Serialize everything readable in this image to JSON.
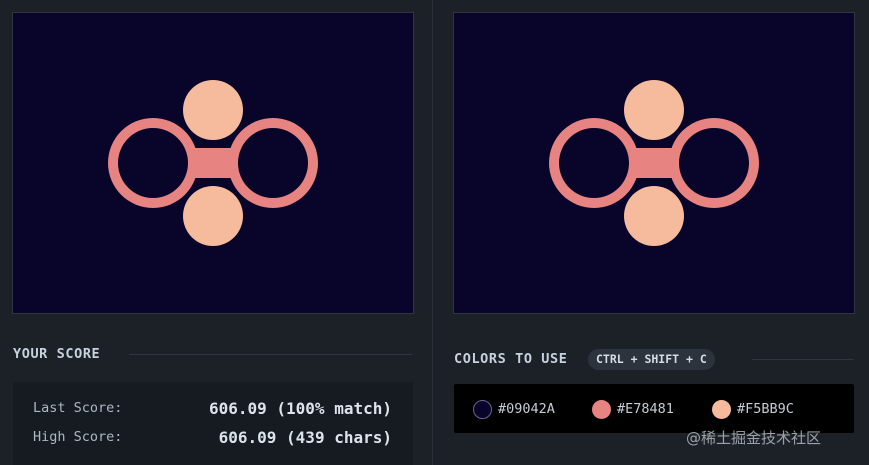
{
  "palette": {
    "background": "#09042A",
    "ring": "#E78481",
    "circle": "#F5BB9C"
  },
  "score": {
    "title": "YOUR SCORE",
    "last_label": "Last Score:",
    "last_value": "606.09 (100% match)",
    "high_label": "High Score:",
    "high_value": "606.09 (439 chars)"
  },
  "colors_section": {
    "title": "COLORS TO USE",
    "shortcut": "CTRL + SHIFT + C",
    "swatches": [
      {
        "code": "#09042A",
        "color": "#09042A"
      },
      {
        "code": "#E78481",
        "color": "#E78481"
      },
      {
        "code": "#F5BB9C",
        "color": "#F5BB9C"
      }
    ]
  },
  "watermark": "@稀土掘金技术社区"
}
